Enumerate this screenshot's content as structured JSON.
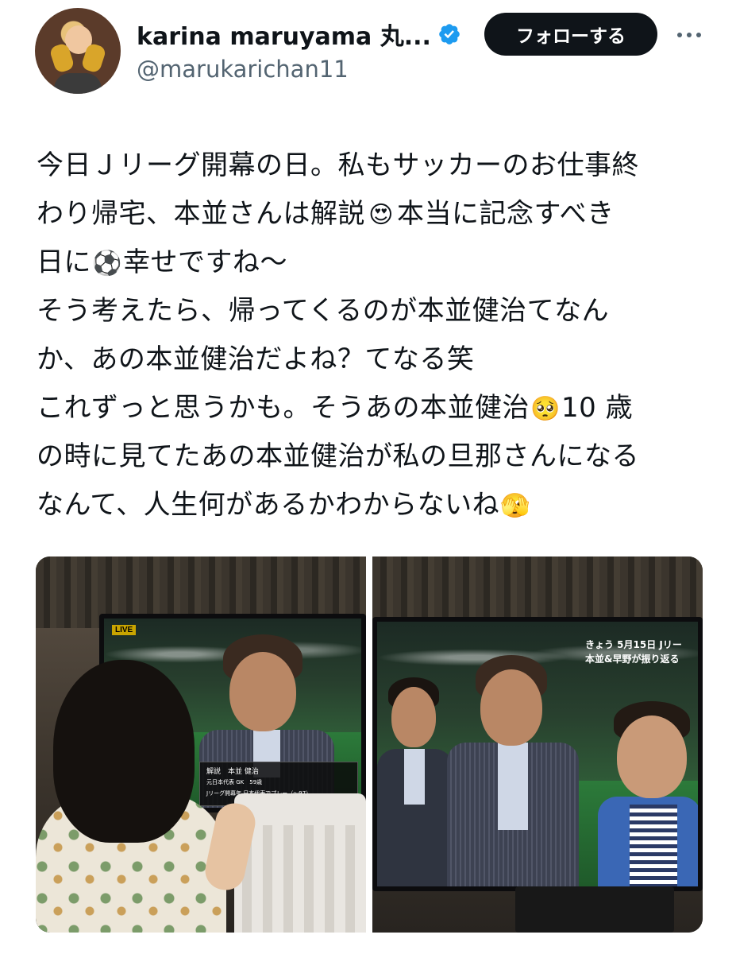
{
  "header": {
    "display_name": "karina maruyama 丸...",
    "handle": "@marukarichan11",
    "follow_label": "フォローする",
    "verified_color": "#1d9bf0",
    "more_icon": "more-dots-icon"
  },
  "tweet": {
    "lines": [
      {
        "text": "今日Ｊリーグ開幕の日。私もサッカーのお仕事終"
      },
      {
        "before": "わり帰宅、本並さんは解説",
        "emoji": "😍",
        "after": "本当に記念すべき"
      },
      {
        "before": "日に",
        "emoji": "⚽",
        "after": "幸せですね〜"
      },
      {
        "text": "そう考えたら、帰ってくるのが本並健治てなん"
      },
      {
        "text": "か、あの本並健治だよね？てなる笑"
      },
      {
        "before": "これずっと思うかも。そうあの本並健治",
        "emoji": "🥺",
        "after": "10 歳"
      },
      {
        "text": "の時に見てたあの本並健治が私の旦那さんになる"
      },
      {
        "before": "なんて、人生何があるかわからないね",
        "emoji": "🫣",
        "after": ""
      }
    ]
  },
  "media": {
    "left_tv": {
      "live": "LIVE",
      "caption_name": "解説　本並 健治",
      "caption_sub1": "元日本代表 GK　59歳",
      "caption_sub2": "Jリーグ開幕年 日本代表でプレー（〜97）"
    },
    "right_tv": {
      "overlay_line1": "きょう 5月15日 Jリー",
      "overlay_line2": "本並&早野が振り返る"
    }
  }
}
